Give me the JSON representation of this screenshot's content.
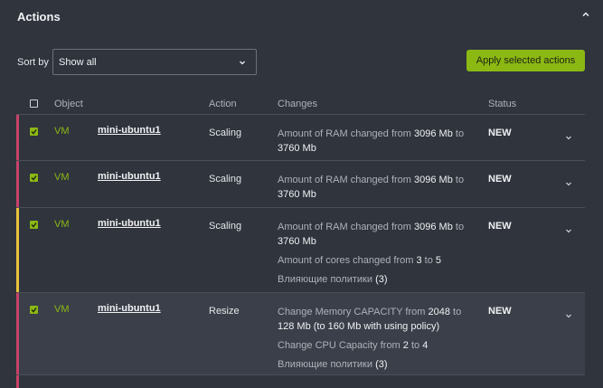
{
  "panel": {
    "title": "Actions"
  },
  "sort": {
    "label": "Sort by",
    "value": "Show all"
  },
  "apply_label": "Apply selected actions",
  "columns": {
    "object": "Object",
    "action": "Action",
    "changes": "Changes",
    "status": "Status"
  },
  "rows": [
    {
      "object": "VM",
      "name": "mini-ubuntu1",
      "action": "Scaling",
      "status": "NEW",
      "c1_pre": "Amount of RAM changed from ",
      "c1_a": "3096 Mb",
      "c1_mid": " to ",
      "c1_b": "3760 Mb",
      "color": "#c8426a"
    },
    {
      "object": "VM",
      "name": "mini-ubuntu1",
      "action": "Scaling",
      "status": "NEW",
      "c1_pre": "Amount of RAM changed from ",
      "c1_a": "3096 Mb",
      "c1_mid": " to ",
      "c1_b": "3760 Mb",
      "color": "#c8426a"
    },
    {
      "object": "VM",
      "name": "mini-ubuntu1",
      "action": "Scaling",
      "status": "NEW",
      "c1_pre": "Amount of RAM changed from ",
      "c1_a": "3096 Mb",
      "c1_mid": " to ",
      "c1_b": "3760 Mb",
      "c2_pre": "Amount of cores changed  from ",
      "c2_a": "3",
      "c2_mid": " to ",
      "c2_b": "5",
      "c3_pre": "Влияющие политики ",
      "c3_a": "(3)",
      "color": "#e9c23a"
    },
    {
      "object": "VM",
      "name": "mini-ubuntu1",
      "action": "Resize",
      "status": "NEW",
      "c1_pre": "Change Memory CAPACITY from ",
      "c1_a": "2048",
      "c1_mid": " to ",
      "c1_b": "128 Mb (to 160 Mb with using policy)",
      "c2_pre": "Change CPU Capacity from ",
      "c2_a": "2",
      "c2_mid": " to ",
      "c2_b": "4",
      "c3_pre": "Влияющие политики ",
      "c3_a": "(3)",
      "color": "#c8426a"
    }
  ],
  "colors": {
    "accent": "#8cb814",
    "bg": "#2f343d",
    "selected_row": "#3a3f49",
    "alert_red": "#c8426a",
    "alert_yellow": "#e9c23a"
  }
}
